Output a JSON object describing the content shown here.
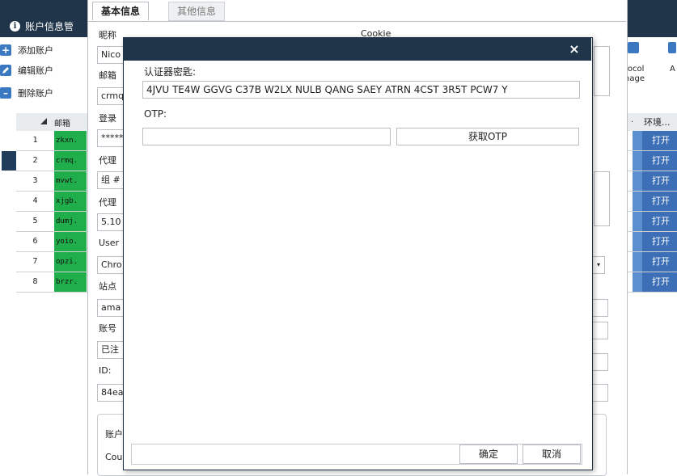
{
  "app": {
    "title": "账户信息管"
  },
  "ribbon": {
    "items": [
      {
        "label": "添加账户",
        "icon": "plus-icon",
        "color": "#3a78c2"
      },
      {
        "label": "编辑账户",
        "icon": "edit-icon",
        "color": "#3a78c2"
      },
      {
        "label": "删除账户",
        "icon": "minus-icon",
        "color": "#3a78c2"
      }
    ],
    "right_tool_label": "tocol\nnage",
    "right_tool_extra": "A"
  },
  "grid": {
    "headers": {
      "email": "邮箱",
      "env": "环境...",
      "dot": "."
    },
    "rows": [
      {
        "num": "1",
        "email": "zkxn.",
        "env": "打开",
        "selected": false
      },
      {
        "num": "2",
        "email": "crmq.",
        "env": "打开",
        "selected": true
      },
      {
        "num": "3",
        "email": "mvwt.",
        "env": "打开",
        "selected": false
      },
      {
        "num": "4",
        "email": "xjgb.",
        "env": "打开",
        "selected": false
      },
      {
        "num": "5",
        "email": "dumj.",
        "env": "打开",
        "selected": false
      },
      {
        "num": "6",
        "email": "yoio.",
        "env": "打开",
        "selected": false
      },
      {
        "num": "7",
        "email": "opzi.",
        "env": "打开",
        "selected": false
      },
      {
        "num": "8",
        "email": "brzr.",
        "env": "打开",
        "selected": false
      }
    ],
    "colors": {
      "email_bg": "#1fae4b",
      "env_bg": "#3d6fb6",
      "header_bg": "#e9ecef"
    }
  },
  "form": {
    "tabs": {
      "basic": "基本信息",
      "other": "其他信息"
    },
    "cookie_label": "Cookie",
    "fields": {
      "nickname_label": "昵称",
      "nickname_value": "Nico",
      "email_label": "邮箱",
      "email_value": "crmq",
      "login_label": "登录",
      "login_value": "*****",
      "proxy_label": "代理",
      "proxy_value": "组 #",
      "proxy2_label": "代理",
      "proxy2_value": "5.10",
      "useragent_label": "User",
      "useragent_value": "Chro",
      "site_label": "站点",
      "site_value": "ama",
      "account_label": "账号",
      "account_value": "已注",
      "id_label": "ID:",
      "id_value": "84ea",
      "group_label": "账户",
      "group_value": "Cou"
    }
  },
  "dialog": {
    "close_glyph": "×",
    "auth_label": "认证器密匙:",
    "auth_value": "4JVU TE4W GGVG C37B W2LX NULB QANG SAEY ATRN 4CST 3R5T PCW7 Y",
    "otp_label": "OTP:",
    "otp_value": "",
    "get_otp_label": "获取OTP",
    "confirm_label": "确定",
    "cancel_label": "取消",
    "colors": {
      "titlebar": "#20354a"
    }
  }
}
